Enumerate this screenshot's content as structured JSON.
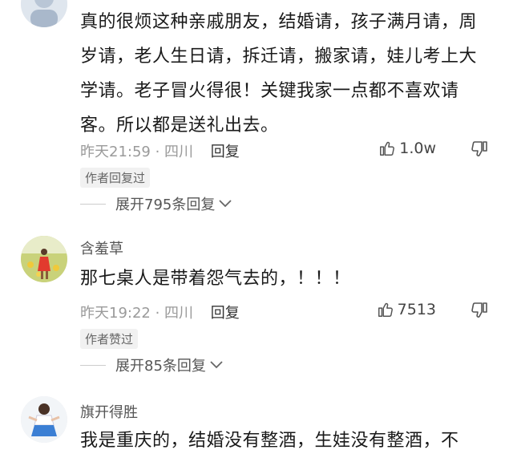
{
  "comments": [
    {
      "username": "",
      "text": "真的很烦这种亲戚朋友，结婚请，孩子满月请，周岁请，老人生日请，拆迁请，搬家请，娃儿考上大学请。老子冒火得很！关键我家一点都不喜欢请客。所以都是送礼出去。",
      "time_location": "昨天21:59 · 四川",
      "reply_label": "回复",
      "likes": "1.0w",
      "badge": "作者回复过",
      "expand_label": "展开795条回复"
    },
    {
      "username": "含羞草",
      "text": "那七桌人是带着怨气去的，！！！",
      "time_location": "昨天19:22 · 四川",
      "reply_label": "回复",
      "likes": "7513",
      "badge": "作者赞过",
      "expand_label": "展开85条回复"
    },
    {
      "username": "旗开得胜",
      "text": "我是重庆的，结婚没有整酒，生娃没有整酒，不"
    }
  ],
  "icons": {
    "like": "thumbs-up-icon",
    "dislike": "thumbs-down-icon",
    "expand": "chevron-down-icon"
  }
}
